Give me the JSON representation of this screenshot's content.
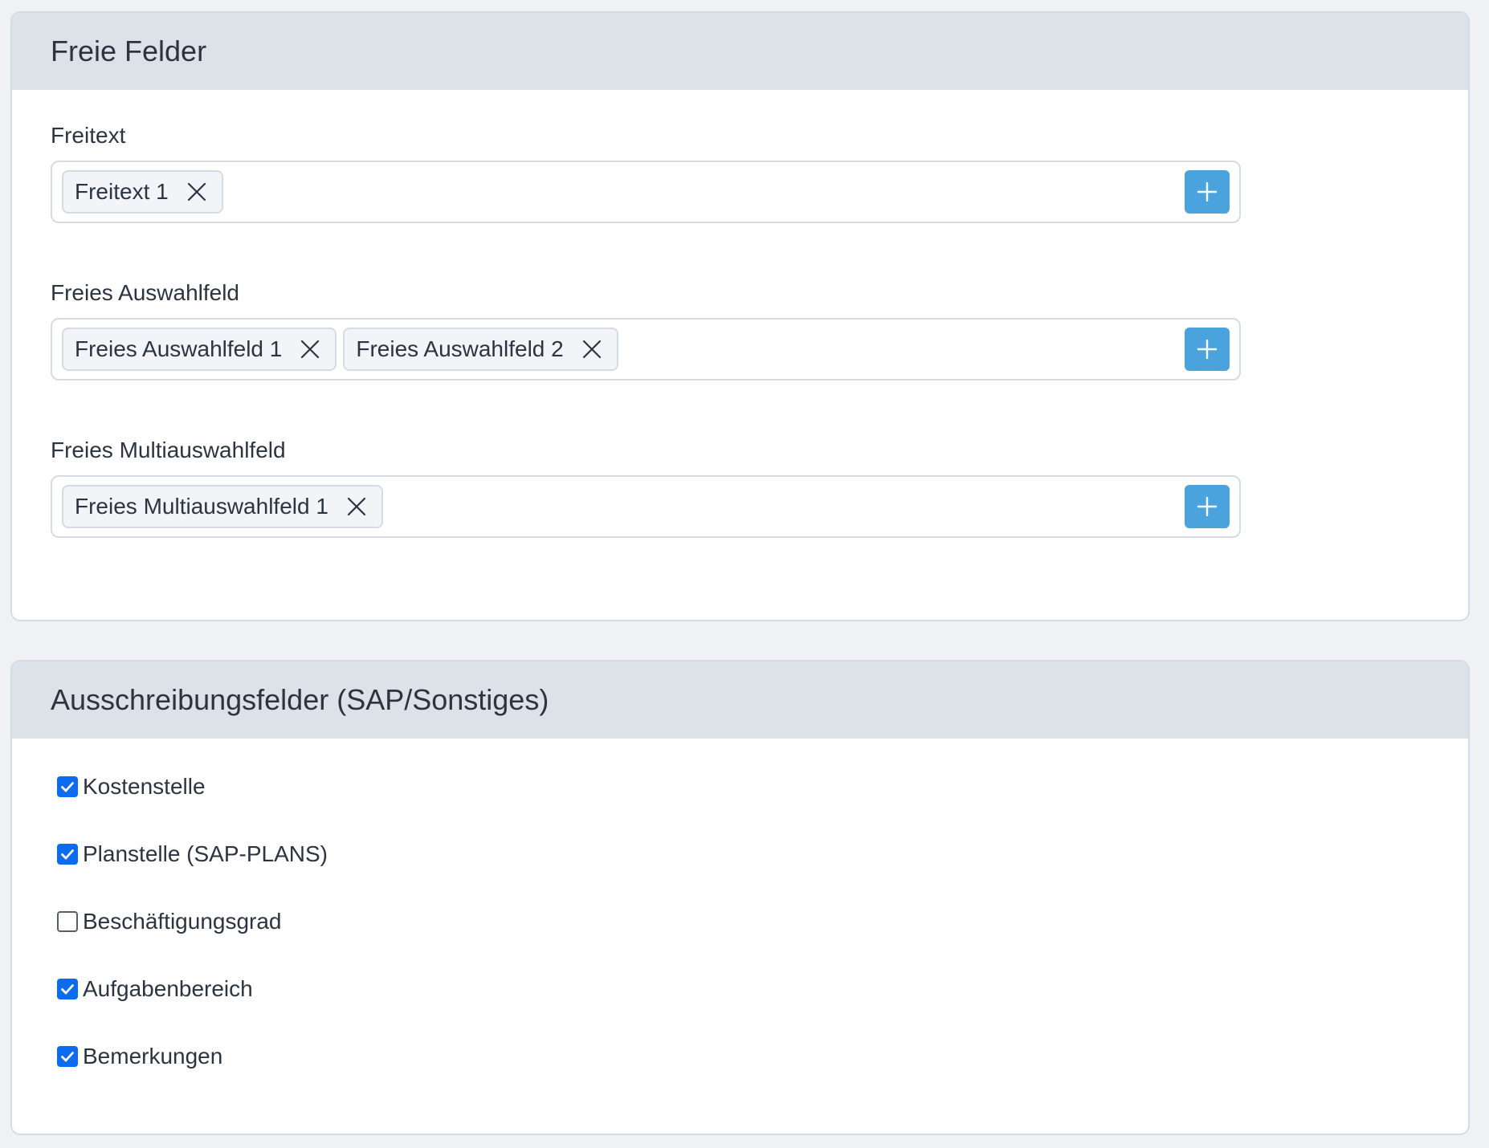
{
  "free_fields": {
    "title": "Freie Felder",
    "groups": [
      {
        "label": "Freitext",
        "tags": [
          "Freitext 1"
        ]
      },
      {
        "label": "Freies Auswahlfeld",
        "tags": [
          "Freies Auswahlfeld 1",
          "Freies Auswahlfeld 2"
        ]
      },
      {
        "label": "Freies Multiauswahlfeld",
        "tags": [
          "Freies Multiauswahlfeld 1"
        ]
      }
    ]
  },
  "tender_fields": {
    "title": "Ausschreibungsfelder (SAP/Sonstiges)",
    "items": [
      {
        "label": "Kostenstelle",
        "checked": true
      },
      {
        "label": "Planstelle (SAP-PLANS)",
        "checked": true
      },
      {
        "label": "Beschäftigungsgrad",
        "checked": false
      },
      {
        "label": "Aufgabenbereich",
        "checked": true
      },
      {
        "label": "Bemerkungen",
        "checked": true
      }
    ]
  },
  "colors": {
    "accent": "#4ba3dd",
    "checkbox": "#0b6cf0",
    "header_bg": "#dde1e8",
    "page_bg": "#eff1f4"
  },
  "icons": {
    "tag_remove": "close-icon",
    "add": "plus-icon",
    "check": "check-icon"
  }
}
